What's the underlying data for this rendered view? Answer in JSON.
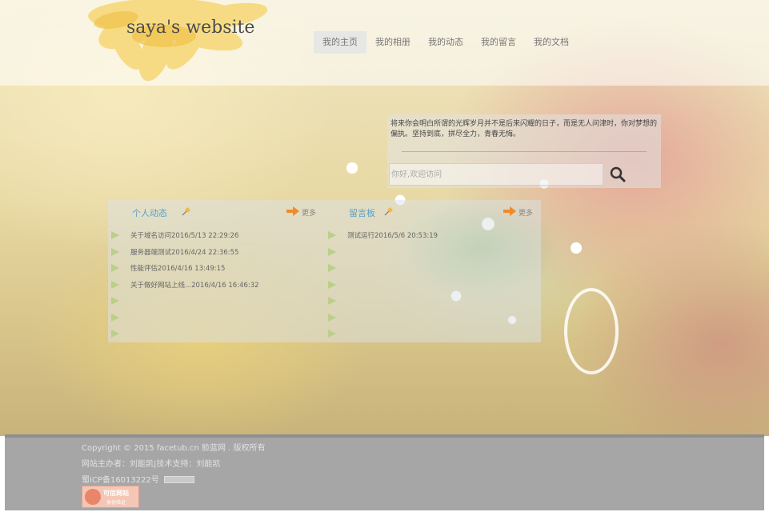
{
  "header": {
    "site_title": "saya's website",
    "nav": [
      {
        "label": "我的主页",
        "active": true
      },
      {
        "label": "我的相册",
        "active": false
      },
      {
        "label": "我的动态",
        "active": false
      },
      {
        "label": "我的留言",
        "active": false
      },
      {
        "label": "我的文档",
        "active": false
      }
    ]
  },
  "quote": {
    "text": "将来你会明白所谓的光辉岁月并不是后来闪耀的日子，而是无人问津时，你对梦想的偏执。坚持到底，拼尽全力，青春无悔。"
  },
  "search": {
    "placeholder": "你好,欢迎访问"
  },
  "panels": {
    "activity": {
      "title": "个人动态",
      "more": "更多",
      "items": [
        "关于域名访问2016/5/13 22:29:26",
        "服务器端测试2016/4/24 22:36:55",
        "性能评估2016/4/16 13:49:15",
        "关于做好网站上线...2016/4/16 16:46:32",
        "",
        "",
        ""
      ]
    },
    "guestbook": {
      "title": "留言板",
      "more": "更多",
      "items": [
        "测试运行2016/5/6 20:53:19",
        "",
        "",
        "",
        "",
        "",
        ""
      ]
    }
  },
  "footer": {
    "copyright": "Copyright © 2015 facetub.cn 脸蓝网 . 版权所有",
    "host": "网站主办者：刘能凯|技术支持：刘能凯",
    "icp": "蜀ICP备16013222号",
    "trust_badge_line1": "可信网站",
    "trust_badge_line2": "身份验证"
  },
  "colors": {
    "accent_blue": "#5aa0c8",
    "list_triangle": "#b9cf8a",
    "more_arrow": "#f08a2a",
    "footer_bg": "#a6a6a6",
    "sunflower": "#f7d774"
  }
}
